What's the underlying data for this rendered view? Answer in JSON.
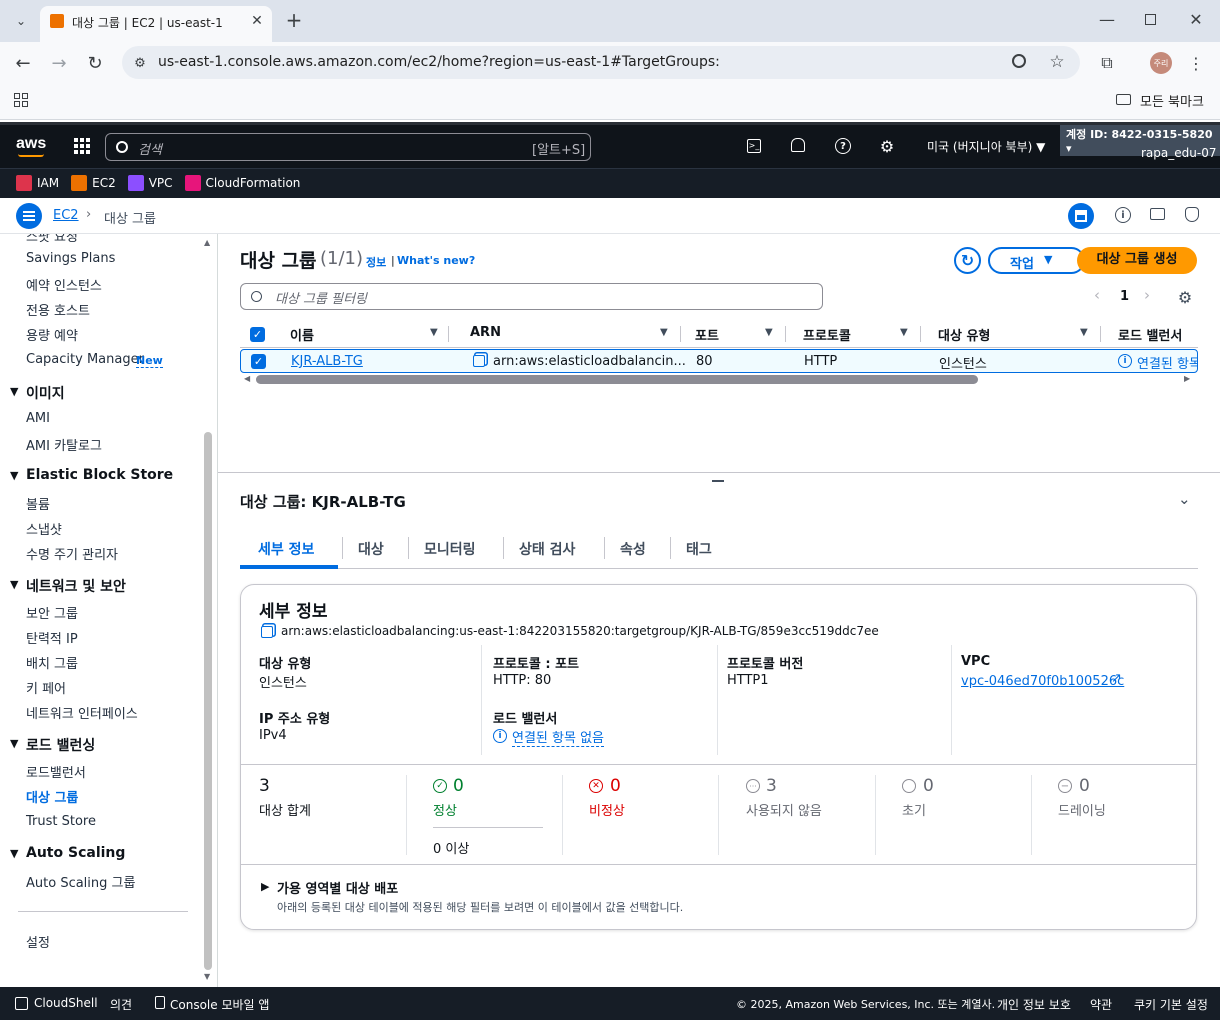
{
  "browser": {
    "tab_title": "대상 그룹 | EC2 | us-east-1",
    "url": "us-east-1.console.aws.amazon.com/ec2/home?region=us-east-1#TargetGroups:",
    "bookmarks_label": "모든 북마크",
    "profile_label": "주리"
  },
  "aws_header": {
    "logo": "aws",
    "search_placeholder": "검색",
    "search_shortcut": "[알트+S]",
    "region": "미국 (버지니아 북부) ▼",
    "account_id": "계정 ID: 8422-0315-5820 ▾",
    "user": "rapa_edu-07"
  },
  "favorites": [
    {
      "label": "IAM",
      "color": "#dd344c"
    },
    {
      "label": "EC2",
      "color": "#ed7100"
    },
    {
      "label": "VPC",
      "color": "#8c4fff"
    },
    {
      "label": "CloudFormation",
      "color": "#e7157b"
    }
  ],
  "breadcrumb": {
    "root": "EC2",
    "current": "대상 그룹"
  },
  "sidebar": {
    "top_clipped": "스팟 요청",
    "items_a": [
      "Savings Plans",
      "예약 인스턴스",
      "전용 호스트",
      "용량 예약"
    ],
    "capacity_manager": "Capacity Manager",
    "new_badge": "New",
    "sec_images": "이미지",
    "images": [
      "AMI",
      "AMI 카탈로그"
    ],
    "sec_ebs": "Elastic Block Store",
    "ebs": [
      "볼륨",
      "스냅샷",
      "수명 주기 관리자"
    ],
    "sec_network": "네트워크 및 보안",
    "network": [
      "보안 그룹",
      "탄력적 IP",
      "배치 그룹",
      "키 페어",
      "네트워크 인터페이스"
    ],
    "sec_lb": "로드 밸런싱",
    "lb": [
      "로드밸런서",
      "대상 그룹",
      "Trust Store"
    ],
    "sec_as": "Auto Scaling",
    "as": [
      "Auto Scaling 그룹"
    ],
    "settings": "설정"
  },
  "list": {
    "title": "대상 그룹",
    "count": "(1/1)",
    "info": "정보",
    "whats_new": "What's new?",
    "actions": "작업",
    "create": "대상 그룹 생성",
    "filter_placeholder": "대상 그룹 필터링",
    "page": "1",
    "columns": [
      "이름",
      "ARN",
      "포트",
      "프로토콜",
      "대상 유형",
      "로드 밸런서"
    ],
    "row": {
      "name": "KJR-ALB-TG",
      "arn": "arn:aws:elasticloadbalancin...",
      "port": "80",
      "protocol": "HTTP",
      "target_type": "인스턴스",
      "load_balancer": "연결된 항목"
    }
  },
  "detail": {
    "header": "대상 그룹: KJR-ALB-TG",
    "tabs": [
      "세부 정보",
      "대상",
      "모니터링",
      "상태 검사",
      "속성",
      "태그"
    ],
    "section_title": "세부 정보",
    "arn": "arn:aws:elasticloadbalancing:us-east-1:842203155820:targetgroup/KJR-ALB-TG/859e3cc519ddc7ee",
    "fields": {
      "target_type_label": "대상 유형",
      "target_type": "인스턴스",
      "protocol_port_label": "프로토콜 : 포트",
      "protocol_port": "HTTP: 80",
      "protocol_version_label": "프로토콜 버전",
      "protocol_version": "HTTP1",
      "vpc_label": "VPC",
      "vpc": "vpc-046ed70f0b100526c",
      "ip_type_label": "IP 주소 유형",
      "ip_type": "IPv4",
      "lb_label": "로드 밸런서",
      "lb": "연결된 항목 없음"
    },
    "stats": {
      "total": "3",
      "total_label": "대상 합계",
      "healthy": "0",
      "healthy_label": "정상",
      "healthy_sub": "0 이상",
      "unhealthy": "0",
      "unhealthy_label": "비정상",
      "unused": "3",
      "unused_label": "사용되지 않음",
      "initial": "0",
      "initial_label": "초기",
      "draining": "0",
      "draining_label": "드레이닝"
    },
    "az_title": "가용 영역별 대상 배포",
    "az_desc": "아래의 등록된 대상 테이블에 적용된 해당 필터를 보려면 이 테이블에서 값을 선택합니다."
  },
  "footer": {
    "cloudshell": "CloudShell",
    "feedback": "의견",
    "mobile": "Console 모바일 앱",
    "copyright": "© 2025, Amazon Web Services, Inc. 또는 계열사.",
    "privacy": "개인 정보 보호",
    "terms": "약관",
    "cookies": "쿠키 기본 설정"
  },
  "colors": {
    "accent": "#006ce0",
    "orange": "#ff9900",
    "success": "#00802f",
    "error": "#db0000"
  }
}
